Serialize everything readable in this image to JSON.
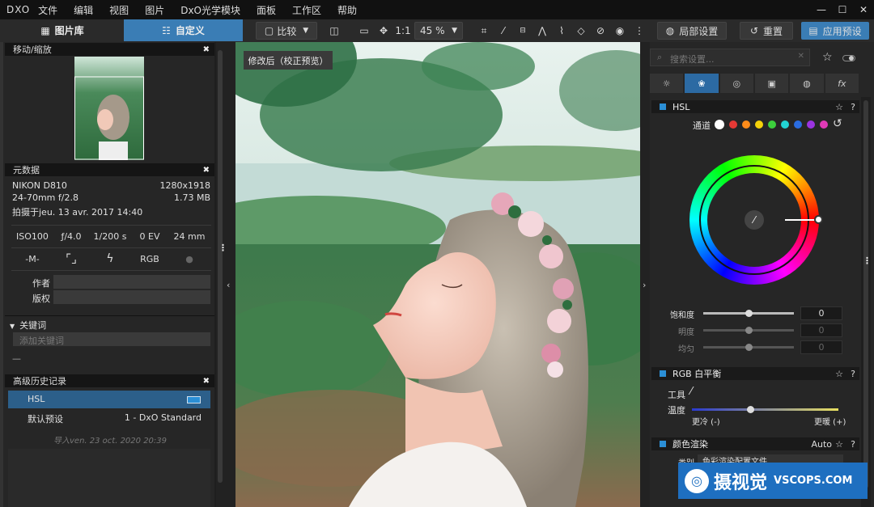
{
  "app": {
    "logo": "DXO"
  },
  "menu": [
    "文件",
    "编辑",
    "视图",
    "图片",
    "DxO光学模块",
    "面板",
    "工作区",
    "帮助"
  ],
  "toolbar": {
    "tab_library": "图片库",
    "tab_customize": "自定义",
    "compare": "比较",
    "one_to_one": "1:1",
    "zoom": "45 %",
    "local_adjust": "局部设置",
    "reset": "重置",
    "apply_preset": "应用预设"
  },
  "left": {
    "move_zoom": {
      "title": "移动/缩放"
    },
    "metadata": {
      "title": "元数据",
      "camera": "NIKON D810",
      "dimensions": "1280x1918",
      "lens": "24-70mm f/2.8",
      "filesize": "1.73 MB",
      "shot_date": "拍摄于jeu. 13 avr. 2017 14:40",
      "exif": [
        "ISO100",
        "ƒ/4.0",
        "1/200 s",
        "0 EV",
        "24 mm"
      ],
      "exif2": [
        "-M-",
        "",
        "",
        "RGB",
        ""
      ],
      "author_label": "作者",
      "copyright_label": "版权"
    },
    "keywords": {
      "title": "关键词",
      "placeholder": "添加关键词",
      "dash": "—"
    },
    "history": {
      "title": "高级历史记录",
      "items": [
        {
          "label": "HSL",
          "value": ""
        },
        {
          "label": "默认预设",
          "value": "1 - DxO Standard"
        }
      ],
      "imported": "导入ven. 23 oct. 2020 20:39"
    }
  },
  "viewer": {
    "badge": "修改后（校正预览）"
  },
  "right": {
    "search_placeholder": "搜索设置...",
    "hsl": {
      "title": "HSL",
      "channel_label": "通道",
      "channel_colors": [
        "#ffffff",
        "#e53935",
        "#ff8c1a",
        "#f5d20a",
        "#3ccf3c",
        "#22d3d3",
        "#2a6ce0",
        "#9b34e0",
        "#e03ab6"
      ],
      "saturation_label": "饱和度",
      "saturation_value": "0",
      "lightness_label": "明度",
      "lightness_value": "0",
      "uniformity_label": "均匀",
      "uniformity_value": "0"
    },
    "wb": {
      "title": "RGB 白平衡",
      "tool_label": "工具",
      "temp_label": "温度",
      "cooler": "更冷 (-)",
      "warmer": "更暖 (+)"
    },
    "color_render": {
      "title": "颜色渲染",
      "auto": "Auto",
      "category_label": "类别",
      "category_value": "色彩渲染配置文件"
    }
  },
  "watermark": {
    "brand": "摄视觉",
    "site": "VSCOPS.COM"
  },
  "colors": {
    "accent": "#2b6fa8",
    "active_tab": "#3a7db5",
    "selected_row": "#2c5f8a"
  }
}
